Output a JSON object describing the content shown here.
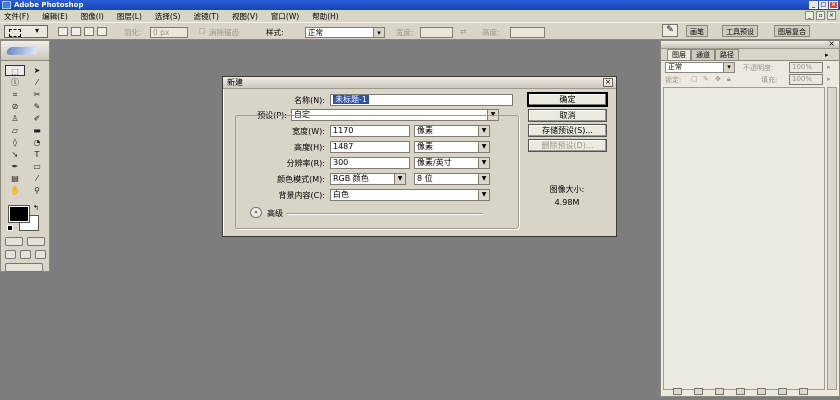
{
  "app": {
    "title": "Adobe Photoshop"
  },
  "menu": [
    "文件(F)",
    "编辑(E)",
    "图像(I)",
    "图层(L)",
    "选择(S)",
    "滤镜(T)",
    "视图(V)",
    "窗口(W)",
    "帮助(H)"
  ],
  "options": {
    "feather_label": "羽化:",
    "feather_value": "0 px",
    "antialias_label": "消除锯齿",
    "style_label": "样式:",
    "style_value": "正常",
    "width_label": "宽度:",
    "height_label": "高度:"
  },
  "palette_well": {
    "tabs": [
      "画笔",
      "工具预设",
      "图层复合"
    ]
  },
  "dialog": {
    "title": "新建",
    "name_label": "名称(N):",
    "name_value": "未标题-1",
    "preset_label": "预设(P):",
    "preset_value": "自定",
    "width_label": "宽度(W):",
    "width_value": "1170",
    "width_unit": "像素",
    "height_label": "高度(H):",
    "height_value": "1487",
    "height_unit": "像素",
    "resolution_label": "分辨率(R):",
    "resolution_value": "300",
    "resolution_unit": "像素/英寸",
    "color_mode_label": "颜色模式(M):",
    "color_mode_value": "RGB 颜色",
    "bit_depth_value": "8 位",
    "background_label": "背景内容(C):",
    "background_value": "白色",
    "advanced_label": "高级",
    "ok_label": "确定",
    "cancel_label": "取消",
    "save_preset_label": "存储预设(S)...",
    "delete_preset_label": "删除预设(D)...",
    "image_size_label": "图像大小:",
    "image_size_value": "4.98M"
  },
  "layers_panel": {
    "tabs": [
      "图层",
      "通道",
      "路径"
    ],
    "blend_mode": "正常",
    "opacity_label": "不透明度:",
    "opacity_value": "100%",
    "lock_label": "锁定:",
    "fill_label": "填充:",
    "fill_value": "100%"
  }
}
